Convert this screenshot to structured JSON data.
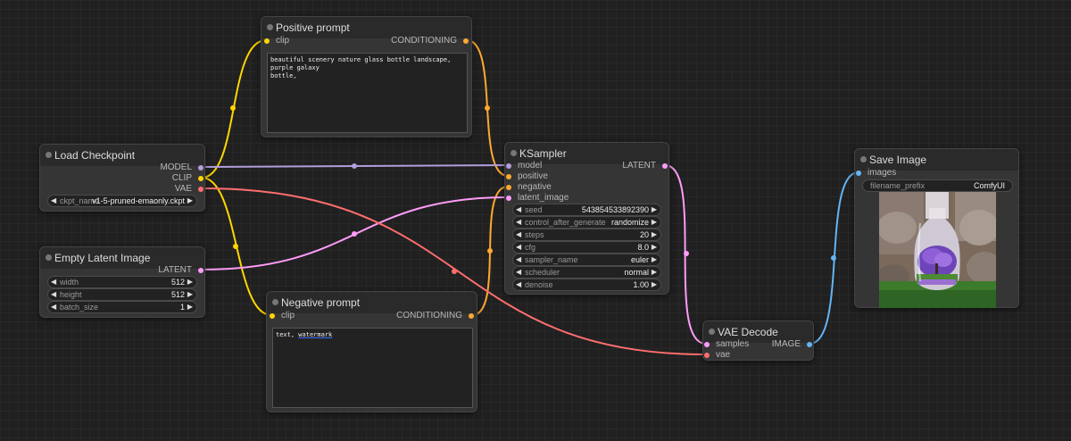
{
  "colors": {
    "model": "#b39ddb",
    "clip": "#ffd500",
    "vae": "#ff6e6e",
    "latent": "#ff9cf9",
    "image": "#64b5f6",
    "conditioning": "#ffa931"
  },
  "nodes": {
    "positive": {
      "title": "Positive prompt",
      "input_clip": "clip",
      "output": "CONDITIONING",
      "text": "beautiful scenery nature glass bottle landscape, purple galaxy\nbottle,"
    },
    "negative": {
      "title": "Negative prompt",
      "input_clip": "clip",
      "output": "CONDITIONING",
      "text_plain": "text, ",
      "text_marked": "watermark"
    },
    "checkpoint": {
      "title": "Load Checkpoint",
      "out_model": "MODEL",
      "out_clip": "CLIP",
      "out_vae": "VAE",
      "ckpt_label": "ckpt_name",
      "ckpt_value": "v1-5-pruned-emaonly.ckpt"
    },
    "latent": {
      "title": "Empty Latent Image",
      "output": "LATENT",
      "widgets": [
        {
          "label": "width",
          "value": "512"
        },
        {
          "label": "height",
          "value": "512"
        },
        {
          "label": "batch_size",
          "value": "1"
        }
      ]
    },
    "ksampler": {
      "title": "KSampler",
      "inputs": [
        "model",
        "positive",
        "negative",
        "latent_image"
      ],
      "output": "LATENT",
      "widgets": [
        {
          "label": "seed",
          "value": "543854533892390"
        },
        {
          "label": "control_after_generate",
          "value": "randomize"
        },
        {
          "label": "steps",
          "value": "20"
        },
        {
          "label": "cfg",
          "value": "8.0"
        },
        {
          "label": "sampler_name",
          "value": "euler"
        },
        {
          "label": "scheduler",
          "value": "normal"
        },
        {
          "label": "denoise",
          "value": "1.00"
        }
      ]
    },
    "vae_decode": {
      "title": "VAE Decode",
      "input_samples": "samples",
      "input_vae": "vae",
      "output": "IMAGE"
    },
    "save_image": {
      "title": "Save Image",
      "input_images": "images",
      "prefix_label": "filename_prefix",
      "prefix_value": "ComfyUI"
    }
  }
}
